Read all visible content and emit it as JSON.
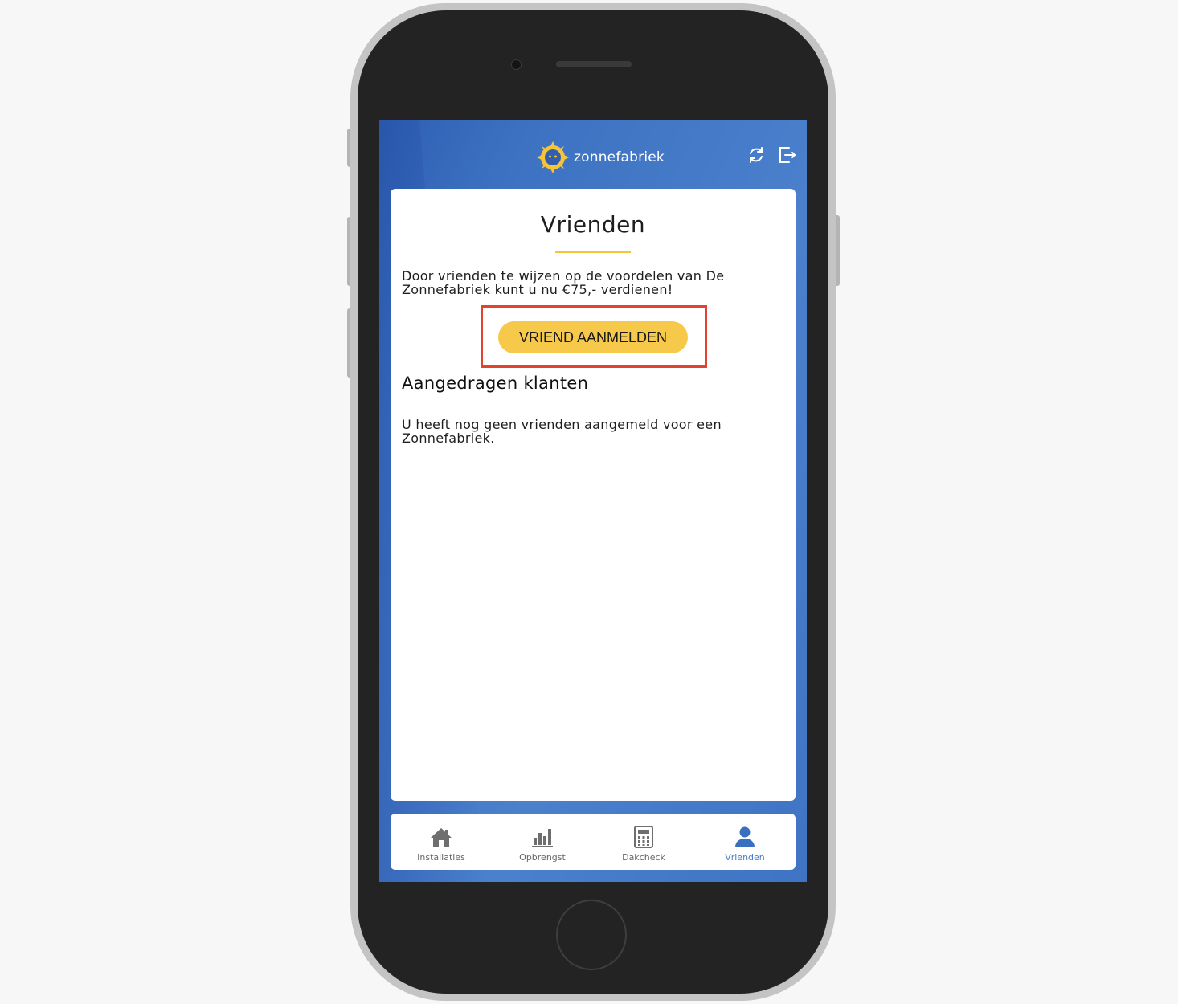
{
  "header": {
    "logo_text": "zonnefabriek",
    "refresh_icon": "refresh-icon",
    "logout_icon": "logout-icon"
  },
  "card": {
    "title": "Vrienden",
    "intro": "Door vrienden te wijzen op de voordelen van De Zonnefabriek kunt u nu €75,- verdienen!",
    "cta_label": "VRIEND AANMELDEN",
    "section_heading": "Aangedragen klanten",
    "empty_message": "U heeft nog geen vrienden aangemeld voor een Zonnefabriek."
  },
  "nav": {
    "items": [
      {
        "label": "Installaties",
        "icon": "home-icon",
        "active": false
      },
      {
        "label": "Opbrengst",
        "icon": "bar-chart-icon",
        "active": false
      },
      {
        "label": "Dakcheck",
        "icon": "calculator-icon",
        "active": false
      },
      {
        "label": "Vrienden",
        "icon": "user-icon",
        "active": true
      }
    ]
  },
  "colors": {
    "brand_blue": "#4a80cc",
    "accent_yellow": "#f7c94a",
    "highlight_red": "#e2432e",
    "active_nav": "#4a7bc8"
  }
}
